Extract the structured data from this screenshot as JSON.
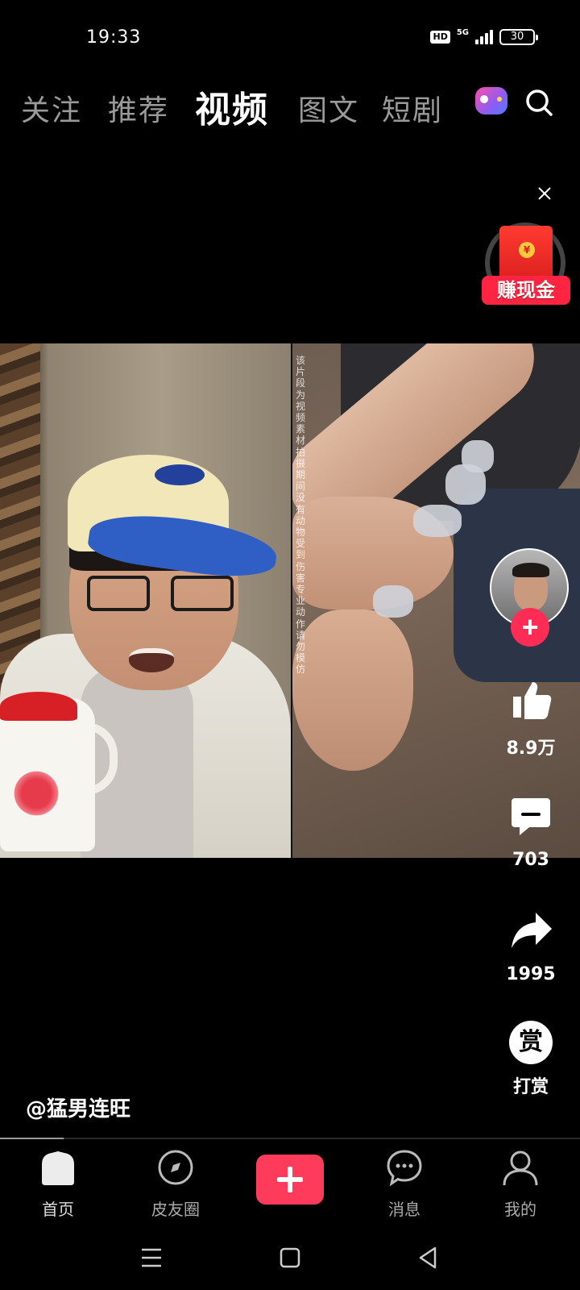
{
  "status_bar": {
    "time": "19:33",
    "hd": "HD",
    "network": "5G",
    "battery": "30"
  },
  "top_tabs": [
    {
      "label": "关注",
      "active": false
    },
    {
      "label": "推荐",
      "active": false
    },
    {
      "label": "视频",
      "active": true
    },
    {
      "label": "图文",
      "active": false
    },
    {
      "label": "短剧",
      "active": false
    }
  ],
  "top_icons": {
    "game": "game-controller-icon",
    "search": "search-icon"
  },
  "reward_widget": {
    "label": "赚现金",
    "coin": "¥"
  },
  "video": {
    "overlay_text": "该片段为视频素材 拍摄期间没有动物受到伤害 专业动作 请勿模仿"
  },
  "actions": {
    "like_count": "8.9万",
    "comment_count": "703",
    "share_count": "1995",
    "tip_icon_text": "赏",
    "tip_label": "打赏"
  },
  "author": {
    "handle": "@猛男连旺"
  },
  "progress": {
    "fraction": 0.11
  },
  "bottom_nav": [
    {
      "label": "首页",
      "icon": "home-icon",
      "active": true
    },
    {
      "label": "皮友圈",
      "icon": "compass-icon",
      "active": false
    },
    {
      "label": "",
      "icon": "create-plus-icon",
      "active": false
    },
    {
      "label": "消息",
      "icon": "message-bubble-icon",
      "active": false
    },
    {
      "label": "我的",
      "icon": "profile-icon",
      "active": false
    }
  ],
  "colors": {
    "accent": "#ff3b5c",
    "follow": "#ff2d55",
    "reward": "#ff2442"
  }
}
